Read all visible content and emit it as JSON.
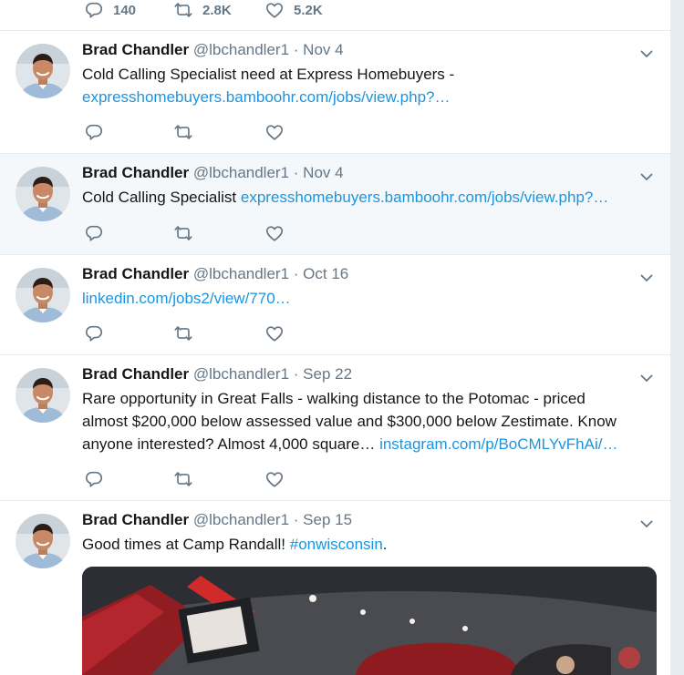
{
  "top_actions": {
    "reply_count": "140",
    "retweet_count": "2.8K",
    "like_count": "5.2K"
  },
  "tweets": [
    {
      "name": "Brad Chandler",
      "handle": "@lbchandler1",
      "dot": "·",
      "date": "Nov 4",
      "text": "Cold Calling Specialist need at Express Homebuyers -",
      "link": "expresshomebuyers.bamboohr.com/jobs/view.php?…"
    },
    {
      "name": "Brad Chandler",
      "handle": "@lbchandler1",
      "dot": "·",
      "date": "Nov 4",
      "text": "Cold Calling Specialist",
      "link": "expresshomebuyers.bamboohr.com/jobs/view.php?…"
    },
    {
      "name": "Brad Chandler",
      "handle": "@lbchandler1",
      "dot": "·",
      "date": "Oct 16",
      "text": "",
      "link": "linkedin.com/jobs2/view/770…"
    },
    {
      "name": "Brad Chandler",
      "handle": "@lbchandler1",
      "dot": "·",
      "date": "Sep 22",
      "line1": "Rare opportunity in Great Falls - walking distance to the Potomac - priced",
      "line2": "almost $200,000 below assessed value and $300,000 below Zestimate. Know",
      "line3": "anyone interested? Almost 4,000 square…",
      "link": "instagram.com/p/BoCMLYvFhAi/…"
    },
    {
      "name": "Brad Chandler",
      "handle": "@lbchandler1",
      "dot": "·",
      "date": "Sep 15",
      "text": "Good times at Camp Randall!",
      "link": "#onwisconsin",
      "trail": "."
    }
  ],
  "colors": {
    "link": "#1b95e0",
    "muted": "#657786",
    "border": "#e6ecf0"
  },
  "icons": [
    "reply-icon",
    "retweet-icon",
    "like-icon",
    "chevron-down-icon"
  ]
}
